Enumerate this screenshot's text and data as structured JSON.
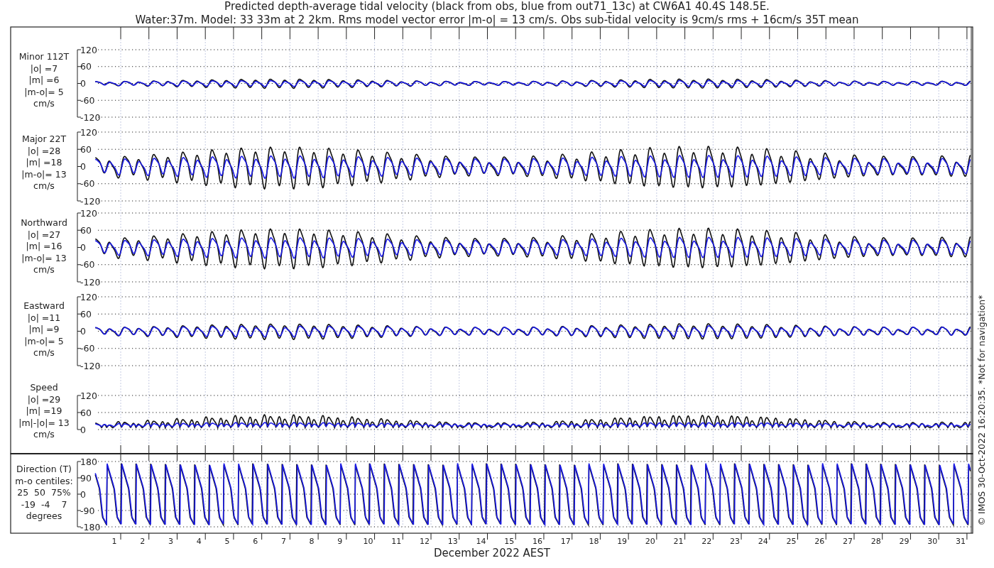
{
  "title_lines": [
    "Predicted depth-average tidal velocity (black from obs, blue from out71_13c) at CW6A1 40.4S 148.5E.",
    "Water:37m. Model: 33 33m at 2 2km. Rms model vector error |m-o| = 13 cm/s. Obs sub-tidal velocity is 9cm/s rms + 16cm/s 35T mean"
  ],
  "panels": [
    {
      "kind": "signed",
      "label_lines": [
        "Minor 112T",
        "|o| =7",
        "|m| =6",
        "|m-o|= 5",
        "cm/s"
      ],
      "yticks": [
        "120",
        "60",
        "0",
        "-60",
        "-120"
      ]
    },
    {
      "kind": "signed",
      "label_lines": [
        "Major 22T",
        "|o| =28",
        "|m| =18",
        "|m-o|= 13",
        "cm/s"
      ],
      "yticks": [
        "120",
        "60",
        "0",
        "-60",
        "-120"
      ]
    },
    {
      "kind": "signed",
      "label_lines": [
        "Northward",
        "|o| =27",
        "|m| =16",
        "|m-o|= 13",
        "cm/s"
      ],
      "yticks": [
        "120",
        "60",
        "0",
        "-60",
        "-120"
      ]
    },
    {
      "kind": "signed",
      "label_lines": [
        "Eastward",
        "|o| =11",
        "|m| =9",
        "|m-o|= 5",
        "cm/s"
      ],
      "yticks": [
        "120",
        "60",
        "0",
        "-60",
        "-120"
      ]
    },
    {
      "kind": "speed",
      "label_lines": [
        "Speed",
        "|o| =29",
        "|m| =19",
        "|m|-|o|= 13",
        "cm/s"
      ],
      "yticks": [
        "120",
        "60",
        "0"
      ]
    },
    {
      "kind": "direction",
      "label_lines": [
        "Direction (T)",
        "m-o centiles:",
        "25  50  75%",
        "-19  -4    7",
        "degrees"
      ],
      "yticks": [
        "180",
        "90",
        "0",
        "-90",
        "-180"
      ]
    }
  ],
  "xtick_labels": [
    "1",
    "2",
    "3",
    "4",
    "5",
    "6",
    "7",
    "8",
    "9",
    "10",
    "11",
    "12",
    "13",
    "14",
    "15",
    "16",
    "17",
    "18",
    "19",
    "20",
    "21",
    "22",
    "23",
    "24",
    "25",
    "26",
    "27",
    "28",
    "29",
    "30",
    "31"
  ],
  "xlabel": "December 2022 AEST",
  "side_note": "© IMOS 30-Oct-2022 16:20:35. *Not for navigation*"
}
